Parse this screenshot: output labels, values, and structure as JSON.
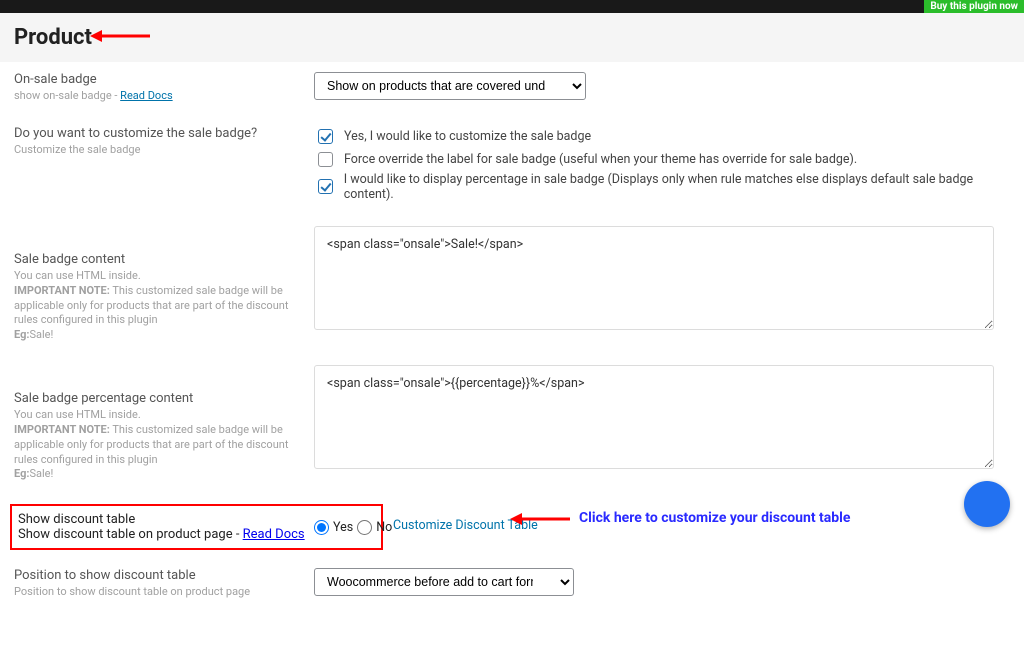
{
  "topbar": {
    "buy_label": "Buy this plugin now"
  },
  "page_title": "Product",
  "onsale_badge": {
    "label": "On-sale badge",
    "desc_prefix": "show on-sale badge - ",
    "docs_link": "Read Docs",
    "select_value": "Show on products that are covered under any discount ru"
  },
  "customize_sale_badge": {
    "label": "Do you want to customize the sale badge?",
    "desc": "Customize the sale badge",
    "options": {
      "opt1": {
        "checked": true,
        "label": "Yes, I would like to customize the sale badge"
      },
      "opt2": {
        "checked": false,
        "label": "Force override the label for sale badge (useful when your theme has override for sale badge)."
      },
      "opt3": {
        "checked": true,
        "label": "I would like to display percentage in sale badge (Displays only when rule matches else displays default sale badge content)."
      }
    }
  },
  "sale_badge_content": {
    "label": "Sale badge content",
    "desc_line1": "You can use HTML inside.",
    "desc_important": "IMPORTANT NOTE:",
    "desc_line2": " This customized sale badge will be applicable only for products that are part of the discount rules configured in this plugin ",
    "desc_eg_bold": "Eg:",
    "desc_eg": "Sale!",
    "value": "<span class=\"onsale\">Sale!</span>"
  },
  "sale_badge_percent": {
    "label": "Sale badge percentage content",
    "desc_line1": "You can use HTML inside.",
    "desc_important": "IMPORTANT NOTE:",
    "desc_line2": " This customized sale badge will be applicable only for products that are part of the discount rules configured in this plugin ",
    "desc_eg_bold": "Eg:",
    "desc_eg": "Sale!",
    "value": "<span class=\"onsale\">{{percentage}}%</span>"
  },
  "show_discount_table": {
    "label": "Show discount table",
    "desc_prefix": "Show discount table on product page - ",
    "docs_link": "Read Docs",
    "yes_label": "Yes",
    "no_label": "No",
    "customize_link": "Customize Discount Table",
    "annotation": "Click here to customize your discount table"
  },
  "position": {
    "label": "Position to show discount table",
    "desc": "Position to show discount table on product page",
    "select_value": "Woocommerce before add to cart form"
  }
}
